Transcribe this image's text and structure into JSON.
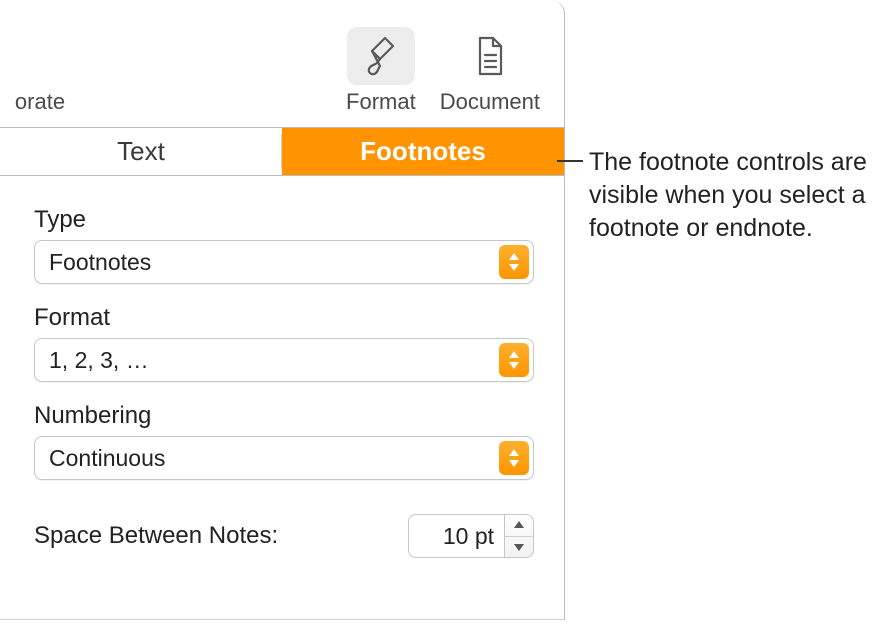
{
  "toolbar": {
    "truncated_label": "orate",
    "format_label": "Format",
    "document_label": "Document"
  },
  "tabs": {
    "text_label": "Text",
    "footnotes_label": "Footnotes"
  },
  "fields": {
    "type": {
      "label": "Type",
      "value": "Footnotes"
    },
    "format": {
      "label": "Format",
      "value": "1, 2, 3, …"
    },
    "numbering": {
      "label": "Numbering",
      "value": "Continuous"
    },
    "space": {
      "label": "Space Between Notes:",
      "value": "10 pt"
    }
  },
  "callout": "The footnote controls are visible when you select a footnote or endnote."
}
